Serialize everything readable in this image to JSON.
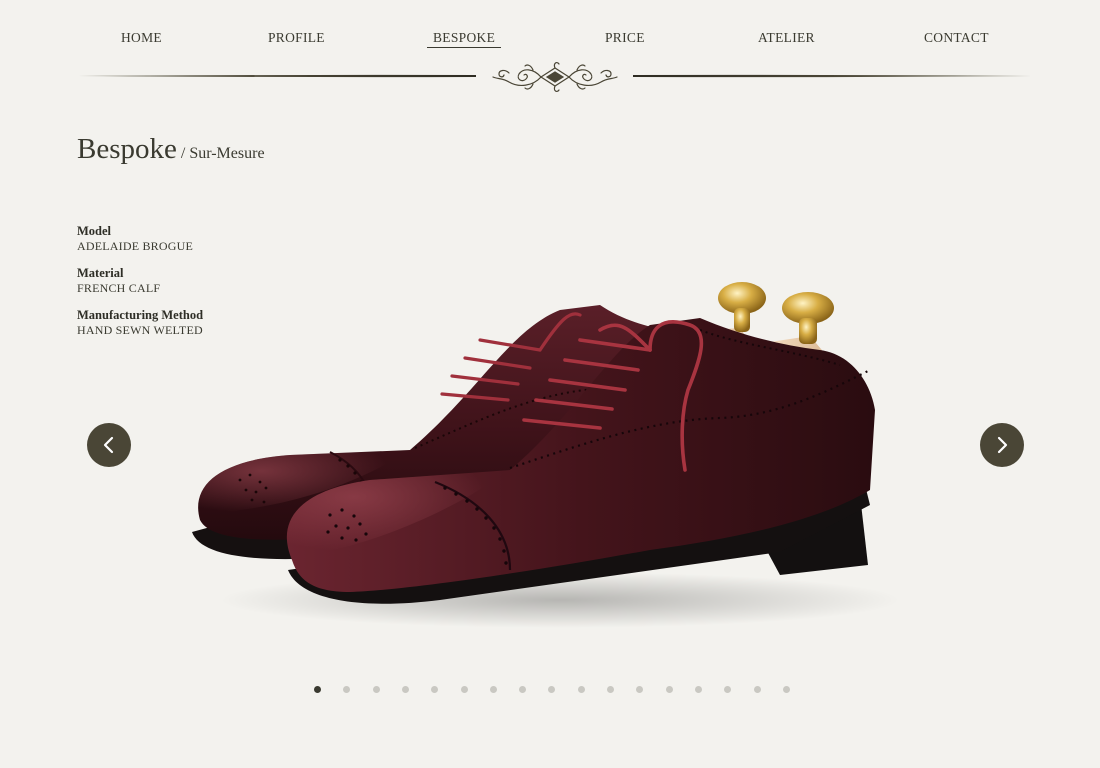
{
  "nav": {
    "items": [
      {
        "label": "HOME"
      },
      {
        "label": "PROFILE"
      },
      {
        "label": "BESPOKE"
      },
      {
        "label": "PRICE"
      },
      {
        "label": "ATELIER"
      },
      {
        "label": "CONTACT"
      }
    ],
    "active": "BESPOKE"
  },
  "page": {
    "title": "Bespoke",
    "subtitle": "/ Sur-Mesure"
  },
  "specs": [
    {
      "label": "Model",
      "value": "ADELAIDE BROGUE"
    },
    {
      "label": "Material",
      "value": "FRENCH CALF"
    },
    {
      "label": "Manufacturing Method",
      "value": "HAND SEWN WELTED"
    }
  ],
  "carousel": {
    "prev_icon": "chevron-left-icon",
    "next_icon": "chevron-right-icon",
    "slide_count": 17,
    "current_slide": 1
  },
  "colors": {
    "background": "#f3f2ee",
    "text": "#3a3a30",
    "arrow_bg": "#4a4636",
    "shoe_leather": "#4a1a22",
    "laces": "#9c2a35",
    "shoe_tree_knob": "#d4a93a"
  }
}
